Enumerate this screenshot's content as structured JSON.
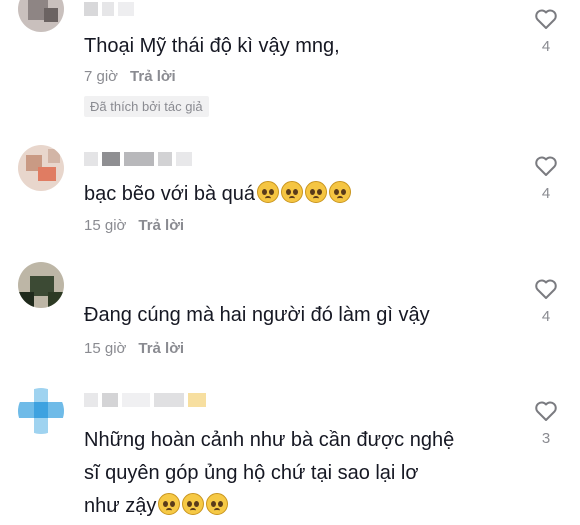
{
  "comments": [
    {
      "text": "Thoại Mỹ thái độ kì vậy mng,",
      "time": "7 giờ",
      "reply": "Trả lời",
      "liked_badge": "Đã thích bởi tác giả",
      "likes": "4",
      "emoji": ""
    },
    {
      "text": "bạc bẽo với bà quá",
      "time": "15 giờ",
      "reply": "Trả lời",
      "likes": "4",
      "emoji": "pleading-face ×4"
    },
    {
      "text": "Đang cúng mà hai người đó làm gì vậy",
      "time": "15 giờ",
      "reply": "Trả lời",
      "likes": "4"
    },
    {
      "text_line1": "Những hoàn cảnh như bà cần được nghệ",
      "text_line2": "sĩ quyên góp ủng hộ chứ tại sao lại lơ",
      "text_line3": "như zậy",
      "likes": "3",
      "emoji": "frowning-face ×3"
    }
  ],
  "icons": {
    "like": "heart-outline-icon"
  },
  "colors": {
    "text": "#161823",
    "meta": "#8a8b91",
    "badge_bg": "#f1f1f2"
  }
}
